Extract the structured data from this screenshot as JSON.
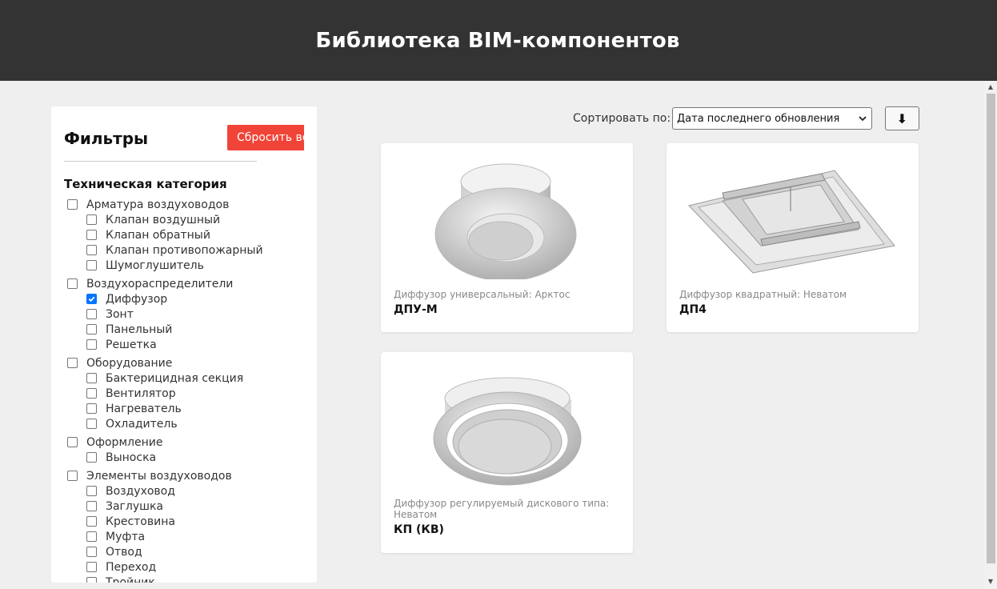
{
  "header": {
    "title": "Библиотека BIM-компонентов"
  },
  "filters": {
    "title": "Фильтры",
    "reset_label": "Сбросить все",
    "section_title": "Техническая категория",
    "groups": [
      {
        "label": "Арматура воздуховодов",
        "checked": false,
        "items": [
          {
            "label": "Клапан воздушный",
            "checked": false
          },
          {
            "label": "Клапан обратный",
            "checked": false
          },
          {
            "label": "Клапан противопожарный",
            "checked": false
          },
          {
            "label": "Шумоглушитель",
            "checked": false
          }
        ]
      },
      {
        "label": "Воздухораспределители",
        "checked": false,
        "items": [
          {
            "label": "Диффузор",
            "checked": true
          },
          {
            "label": "Зонт",
            "checked": false
          },
          {
            "label": "Панельный",
            "checked": false
          },
          {
            "label": "Решетка",
            "checked": false
          }
        ]
      },
      {
        "label": "Оборудование",
        "checked": false,
        "items": [
          {
            "label": "Бактерицидная секция",
            "checked": false
          },
          {
            "label": "Вентилятор",
            "checked": false
          },
          {
            "label": "Нагреватель",
            "checked": false
          },
          {
            "label": "Охладитель",
            "checked": false
          }
        ]
      },
      {
        "label": "Оформление",
        "checked": false,
        "items": [
          {
            "label": "Выноска",
            "checked": false
          }
        ]
      },
      {
        "label": "Элементы воздуховодов",
        "checked": false,
        "items": [
          {
            "label": "Воздуховод",
            "checked": false
          },
          {
            "label": "Заглушка",
            "checked": false
          },
          {
            "label": "Крестовина",
            "checked": false
          },
          {
            "label": "Муфта",
            "checked": false
          },
          {
            "label": "Отвод",
            "checked": false
          },
          {
            "label": "Переход",
            "checked": false
          },
          {
            "label": "Тройник",
            "checked": false
          }
        ]
      }
    ]
  },
  "sort": {
    "label": "Сортировать по:",
    "selected": "Дата последнего обновления",
    "direction_icon": "arrow-down-icon",
    "direction_glyph": "⬇"
  },
  "cards": [
    {
      "description": "Диффузор универсальный: Арктос",
      "name": "ДПУ-М",
      "image": "round-diffuser-icon"
    },
    {
      "description": "Диффузор квадратный: Неватом",
      "name": "ДП4",
      "image": "square-diffuser-icon"
    },
    {
      "description": "Диффузор регулируемый дискового типа: Неватом",
      "name": "КП (КВ)",
      "image": "disc-diffuser-icon"
    }
  ],
  "colors": {
    "header_bg": "#333333",
    "reset_bg": "#f04438",
    "checkbox_checked": "#0075ff",
    "page_bg": "#efefef"
  }
}
